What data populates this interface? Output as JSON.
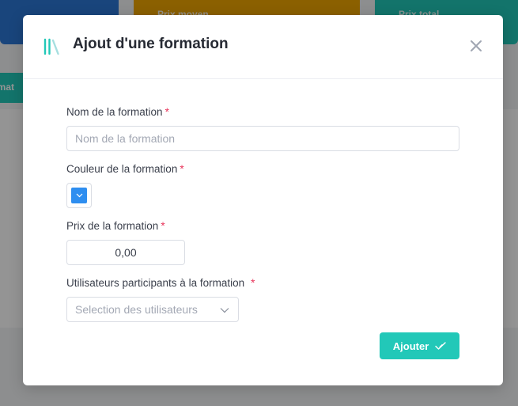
{
  "background": {
    "cards": [
      {
        "label": "",
        "color": "#2b78d6"
      },
      {
        "label": "Prix moyen",
        "color": "#f0a500"
      },
      {
        "label": "Prix total",
        "color": "#22c8b8"
      }
    ],
    "tab_label": "rmat"
  },
  "modal": {
    "title": "Ajout d'une formation",
    "icon": "books-icon",
    "close_icon": "close-icon"
  },
  "form": {
    "required_marker": "*",
    "name": {
      "label": "Nom de la formation",
      "placeholder": "Nom de la formation",
      "value": ""
    },
    "color": {
      "label": "Couleur de la formation",
      "value": "#2e8ef0"
    },
    "price": {
      "label": "Prix de la formation",
      "value": "0,00"
    },
    "participants": {
      "label": "Utilisateurs participants à la formation",
      "placeholder": "Selection des utilisateurs"
    }
  },
  "submit": {
    "label": "Ajouter",
    "icon": "check-icon"
  },
  "colors": {
    "accent": "#22c8b8",
    "required": "#e8345a"
  }
}
